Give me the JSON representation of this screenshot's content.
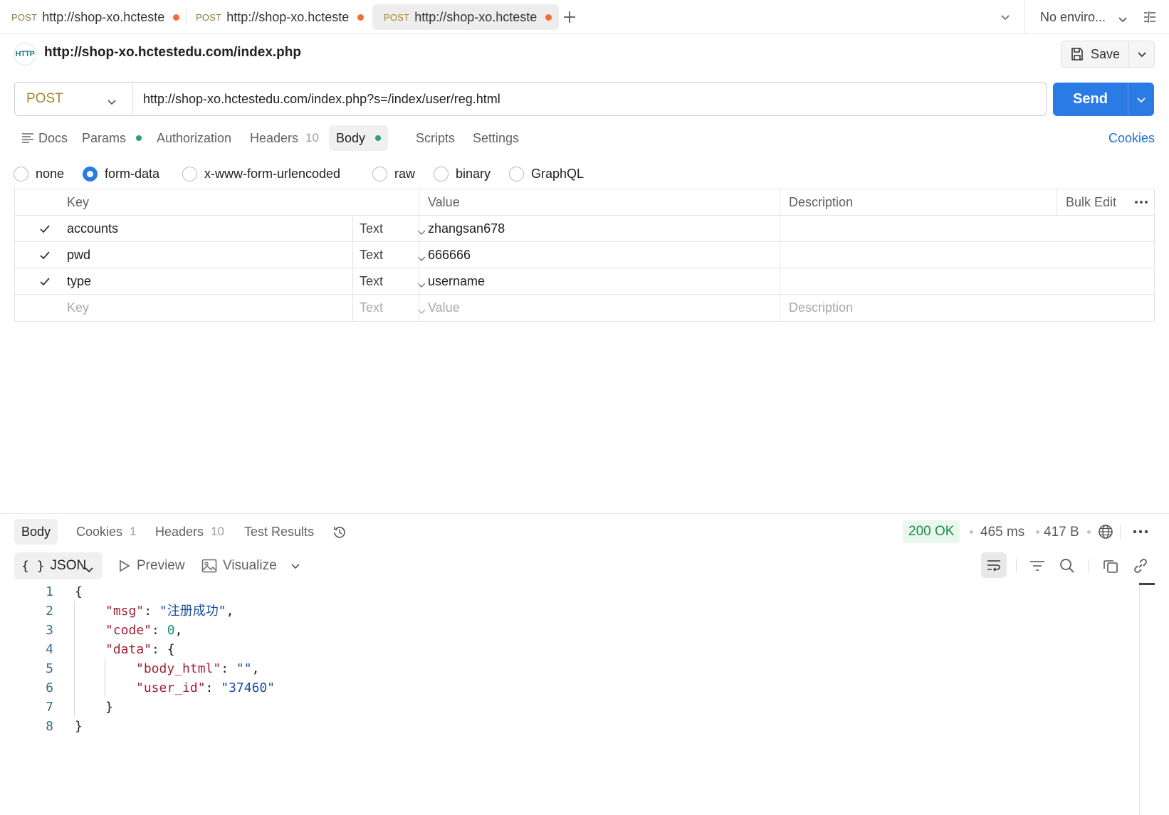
{
  "tabs": [
    {
      "method": "POST",
      "url": "http://shop-xo.hcteste",
      "active": false
    },
    {
      "method": "POST",
      "url": "http://shop-xo.hcteste",
      "active": false
    },
    {
      "method": "POST",
      "url": "http://shop-xo.hcteste",
      "active": true
    }
  ],
  "environment": {
    "selected": "No enviro..."
  },
  "request": {
    "title": "http://shop-xo.hctestedu.com/index.php",
    "badge": "HTTP",
    "save_label": "Save",
    "method": "POST",
    "url": "http://shop-xo.hctestedu.com/index.php?s=/index/user/reg.html",
    "send_label": "Send"
  },
  "request_tabs": {
    "docs": "Docs",
    "params": "Params",
    "authorization": "Authorization",
    "headers": "Headers",
    "headers_count": "10",
    "body": "Body",
    "scripts": "Scripts",
    "settings": "Settings",
    "cookies": "Cookies"
  },
  "body_types": {
    "selected": "form-data",
    "options": [
      "none",
      "form-data",
      "x-www-form-urlencoded",
      "raw",
      "binary",
      "GraphQL"
    ]
  },
  "form_table": {
    "headers": {
      "key": "Key",
      "value": "Value",
      "description": "Description",
      "bulk_edit": "Bulk Edit"
    },
    "rows": [
      {
        "checked": true,
        "key": "accounts",
        "type": "Text",
        "value": "zhangsan678",
        "description": ""
      },
      {
        "checked": true,
        "key": "pwd",
        "type": "Text",
        "value": "666666",
        "description": ""
      },
      {
        "checked": true,
        "key": "type",
        "type": "Text",
        "value": "username",
        "description": ""
      }
    ],
    "placeholder": {
      "key": "Key",
      "type": "Text",
      "value": "Value",
      "description": "Description"
    }
  },
  "response": {
    "tabs": {
      "body": "Body",
      "cookies": "Cookies",
      "cookies_count": "1",
      "headers": "Headers",
      "headers_count": "10",
      "test_results": "Test Results"
    },
    "status": "200 OK",
    "time": "465 ms",
    "size": "417 B",
    "format": "JSON",
    "preview_label": "Preview",
    "visualize_label": "Visualize",
    "code_lines": [
      {
        "n": "1",
        "indent": 0,
        "parts": [
          [
            "p",
            "{"
          ]
        ]
      },
      {
        "n": "2",
        "indent": 1,
        "parts": [
          [
            "k",
            "\"msg\""
          ],
          [
            "p",
            ": "
          ],
          [
            "s",
            "\"注册成功\""
          ],
          [
            "p",
            ","
          ]
        ]
      },
      {
        "n": "3",
        "indent": 1,
        "parts": [
          [
            "k",
            "\"code\""
          ],
          [
            "p",
            ": "
          ],
          [
            "n",
            "0"
          ],
          [
            "p",
            ","
          ]
        ]
      },
      {
        "n": "4",
        "indent": 1,
        "parts": [
          [
            "k",
            "\"data\""
          ],
          [
            "p",
            ": {"
          ]
        ]
      },
      {
        "n": "5",
        "indent": 2,
        "parts": [
          [
            "k",
            "\"body_html\""
          ],
          [
            "p",
            ": "
          ],
          [
            "s",
            "\"\""
          ],
          [
            "p",
            ","
          ]
        ]
      },
      {
        "n": "6",
        "indent": 2,
        "parts": [
          [
            "k",
            "\"user_id\""
          ],
          [
            "p",
            ": "
          ],
          [
            "s",
            "\"37460\""
          ]
        ]
      },
      {
        "n": "7",
        "indent": 1,
        "parts": [
          [
            "p",
            "}"
          ]
        ]
      },
      {
        "n": "8",
        "indent": 0,
        "parts": [
          [
            "p",
            "}"
          ]
        ]
      }
    ]
  },
  "colors": {
    "accent": "#2a7be4",
    "method": "#a8862a",
    "status_ok": "#1e8a4a",
    "unsaved_dot": "#f26b3a"
  }
}
